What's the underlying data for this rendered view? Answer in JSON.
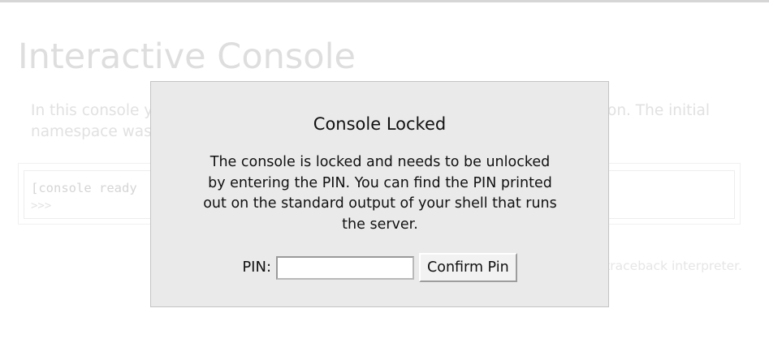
{
  "page": {
    "title": "Interactive Console",
    "intro_visible_fragments": {
      "left_line1": "In this console yo",
      "right_line1": "on. The initial",
      "left_line2": "namespace was c"
    },
    "console": {
      "ready_fragment": "[console ready",
      "prompt": ">>>"
    },
    "footer_fragment": "traceback interpreter."
  },
  "modal": {
    "title": "Console Locked",
    "message": "The console is locked and needs to be unlocked by entering the PIN. You can find the PIN printed out on the standard output of your shell that runs the server.",
    "pin_label": "PIN:",
    "pin_value": "",
    "confirm_label": "Confirm Pin"
  }
}
